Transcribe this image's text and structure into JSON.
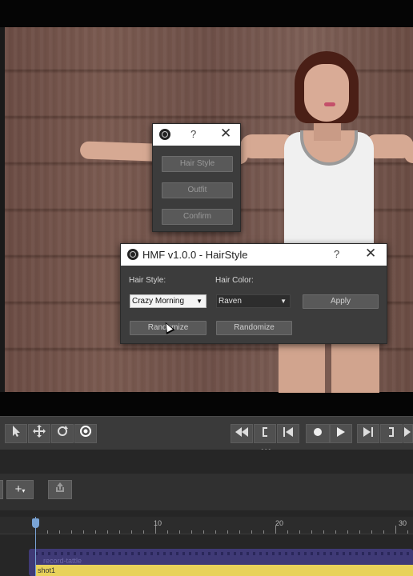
{
  "menu_dialog": {
    "help_glyph": "?",
    "close_glyph": "✕",
    "buttons": [
      "Hair Style",
      "Outfit",
      "Confirm"
    ]
  },
  "hairstyle_dialog": {
    "title": "HMF v1.0.0 - HairStyle",
    "help_glyph": "?",
    "close_glyph": "✕",
    "hair_style_label": "Hair Style:",
    "hair_color_label": "Hair Color:",
    "hair_style_value": "Crazy Morning",
    "hair_color_value": "Raven",
    "apply_label": "Apply",
    "randomize_style_label": "Randomize",
    "randomize_color_label": "Randomize"
  },
  "controls": {
    "tools": [
      "select-arrow-icon",
      "move-icon",
      "rotate-icon",
      "target-icon"
    ],
    "transport": [
      "rewind-icon",
      "mark-in-icon",
      "previous-frame-icon",
      "record-icon",
      "play-icon",
      "next-frame-icon",
      "mark-out-icon",
      "fast-forward-icon"
    ]
  },
  "timeline": {
    "ruler_labels": [
      "10",
      "20",
      "30"
    ],
    "track_label": "record-tattle",
    "shot_label": "shot1",
    "add_glyph": "+"
  }
}
